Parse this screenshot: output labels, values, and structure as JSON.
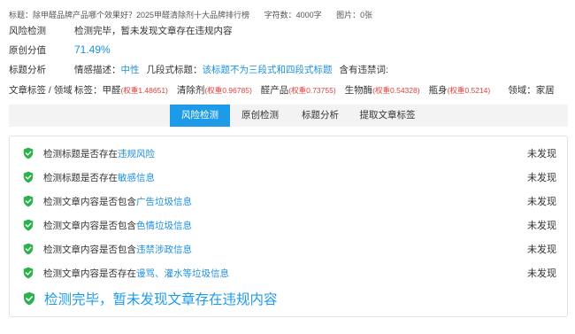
{
  "meta": {
    "title_label": "标题：",
    "title": "除甲醛品牌产品哪个效果好？2025甲醛清除剂十大品牌排行榜",
    "wordcount_label": "字符数：",
    "wordcount": "4000字",
    "images_label": "图片：",
    "images": "0张"
  },
  "risk": {
    "label": "风险检测",
    "value": "检测完毕，暂未发现文章存在违规内容"
  },
  "original": {
    "label": "原创分值",
    "value": "71.49%"
  },
  "title_analysis": {
    "label": "标题分析",
    "sentiment_label": "情感描述：",
    "sentiment": "中性",
    "structure_label": "几段式标题：",
    "structure": "该标题不为三段式和四段式标题",
    "banned_label": "含有违禁词:",
    "banned": ""
  },
  "tags": {
    "label": "文章标签 / 领域",
    "tags_label": "标签：",
    "items": [
      {
        "word": "甲醛",
        "weight": "(权重1.48651)"
      },
      {
        "word": "清除剂",
        "weight": "(权重0.96785)"
      },
      {
        "word": "醛产品",
        "weight": "(权重0.73755)"
      },
      {
        "word": "生物酶",
        "weight": "(权重0.54328)"
      },
      {
        "word": "瓶身",
        "weight": "(权重0.5214)"
      }
    ],
    "field_label": "领域：",
    "field": "家居"
  },
  "tabs": [
    "风险检测",
    "原创检测",
    "标题分析",
    "提取文章标签"
  ],
  "checks": [
    {
      "prefix": "检测标题是否存在",
      "highlight": "违规风险",
      "status": "未发现"
    },
    {
      "prefix": "检测标题是否存在",
      "highlight": "敏感信息",
      "status": "未发现"
    },
    {
      "prefix": "检测文章内容是否包含",
      "highlight": "广告垃圾信息",
      "status": "未发现"
    },
    {
      "prefix": "检测文章内容是否包含",
      "highlight": "色情垃圾信息",
      "status": "未发现"
    },
    {
      "prefix": "检测文章内容是否包含",
      "highlight": "违禁涉政信息",
      "status": "未发现"
    },
    {
      "prefix": "检测文章内容是否存在",
      "highlight": "谩骂、灌水等垃圾信息",
      "status": "未发现"
    }
  ],
  "final_message": "检测完毕，暂未发现文章存在违规内容",
  "colors": {
    "accent": "#1e9be8",
    "shield": "#2bb24c",
    "weight": "#e0403c"
  }
}
